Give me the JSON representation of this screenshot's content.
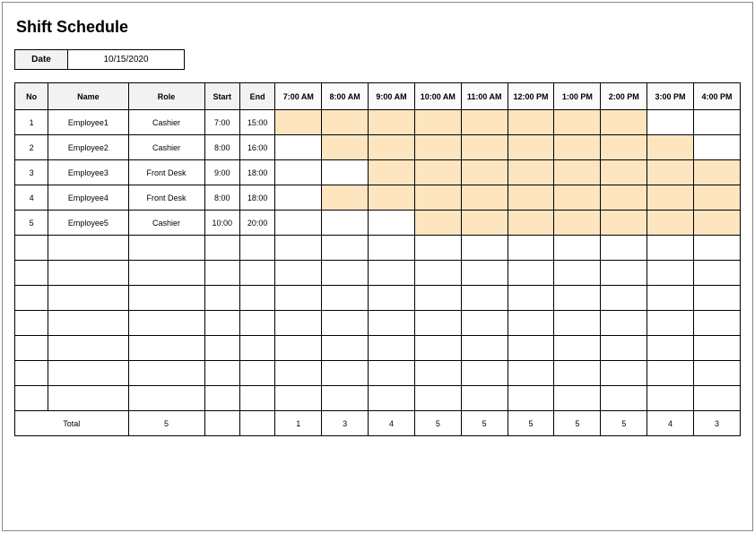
{
  "title": "Shift Schedule",
  "date_label": "Date",
  "date_value": "10/15/2020",
  "headers": {
    "no": "No",
    "name": "Name",
    "role": "Role",
    "start": "Start",
    "end": "End",
    "hours": [
      "7:00 AM",
      "8:00 AM",
      "9:00 AM",
      "10:00 AM",
      "11:00 AM",
      "12:00 PM",
      "1:00 PM",
      "2:00 PM",
      "3:00 PM",
      "4:00 PM"
    ]
  },
  "rows": [
    {
      "no": "1",
      "name": "Employee1",
      "role": "Cashier",
      "start": "7:00",
      "end": "15:00",
      "shift": [
        true,
        true,
        true,
        true,
        true,
        true,
        true,
        true,
        false,
        false
      ]
    },
    {
      "no": "2",
      "name": "Employee2",
      "role": "Cashier",
      "start": "8:00",
      "end": "16:00",
      "shift": [
        false,
        true,
        true,
        true,
        true,
        true,
        true,
        true,
        true,
        false
      ]
    },
    {
      "no": "3",
      "name": "Employee3",
      "role": "Front Desk",
      "start": "9:00",
      "end": "18:00",
      "shift": [
        false,
        false,
        true,
        true,
        true,
        true,
        true,
        true,
        true,
        true
      ]
    },
    {
      "no": "4",
      "name": "Employee4",
      "role": "Front Desk",
      "start": "8:00",
      "end": "18:00",
      "shift": [
        false,
        true,
        true,
        true,
        true,
        true,
        true,
        true,
        true,
        true
      ]
    },
    {
      "no": "5",
      "name": "Employee5",
      "role": "Cashier",
      "start": "10:00",
      "end": "20:00",
      "shift": [
        false,
        false,
        false,
        true,
        true,
        true,
        true,
        true,
        true,
        true
      ]
    },
    {
      "no": "",
      "name": "",
      "role": "",
      "start": "",
      "end": "",
      "shift": [
        false,
        false,
        false,
        false,
        false,
        false,
        false,
        false,
        false,
        false
      ]
    },
    {
      "no": "",
      "name": "",
      "role": "",
      "start": "",
      "end": "",
      "shift": [
        false,
        false,
        false,
        false,
        false,
        false,
        false,
        false,
        false,
        false
      ]
    },
    {
      "no": "",
      "name": "",
      "role": "",
      "start": "",
      "end": "",
      "shift": [
        false,
        false,
        false,
        false,
        false,
        false,
        false,
        false,
        false,
        false
      ]
    },
    {
      "no": "",
      "name": "",
      "role": "",
      "start": "",
      "end": "",
      "shift": [
        false,
        false,
        false,
        false,
        false,
        false,
        false,
        false,
        false,
        false
      ]
    },
    {
      "no": "",
      "name": "",
      "role": "",
      "start": "",
      "end": "",
      "shift": [
        false,
        false,
        false,
        false,
        false,
        false,
        false,
        false,
        false,
        false
      ]
    },
    {
      "no": "",
      "name": "",
      "role": "",
      "start": "",
      "end": "",
      "shift": [
        false,
        false,
        false,
        false,
        false,
        false,
        false,
        false,
        false,
        false
      ]
    },
    {
      "no": "",
      "name": "",
      "role": "",
      "start": "",
      "end": "",
      "shift": [
        false,
        false,
        false,
        false,
        false,
        false,
        false,
        false,
        false,
        false
      ]
    }
  ],
  "total": {
    "label": "Total",
    "role_count": "5",
    "hours": [
      "1",
      "3",
      "4",
      "5",
      "5",
      "5",
      "5",
      "5",
      "4",
      "3"
    ]
  }
}
